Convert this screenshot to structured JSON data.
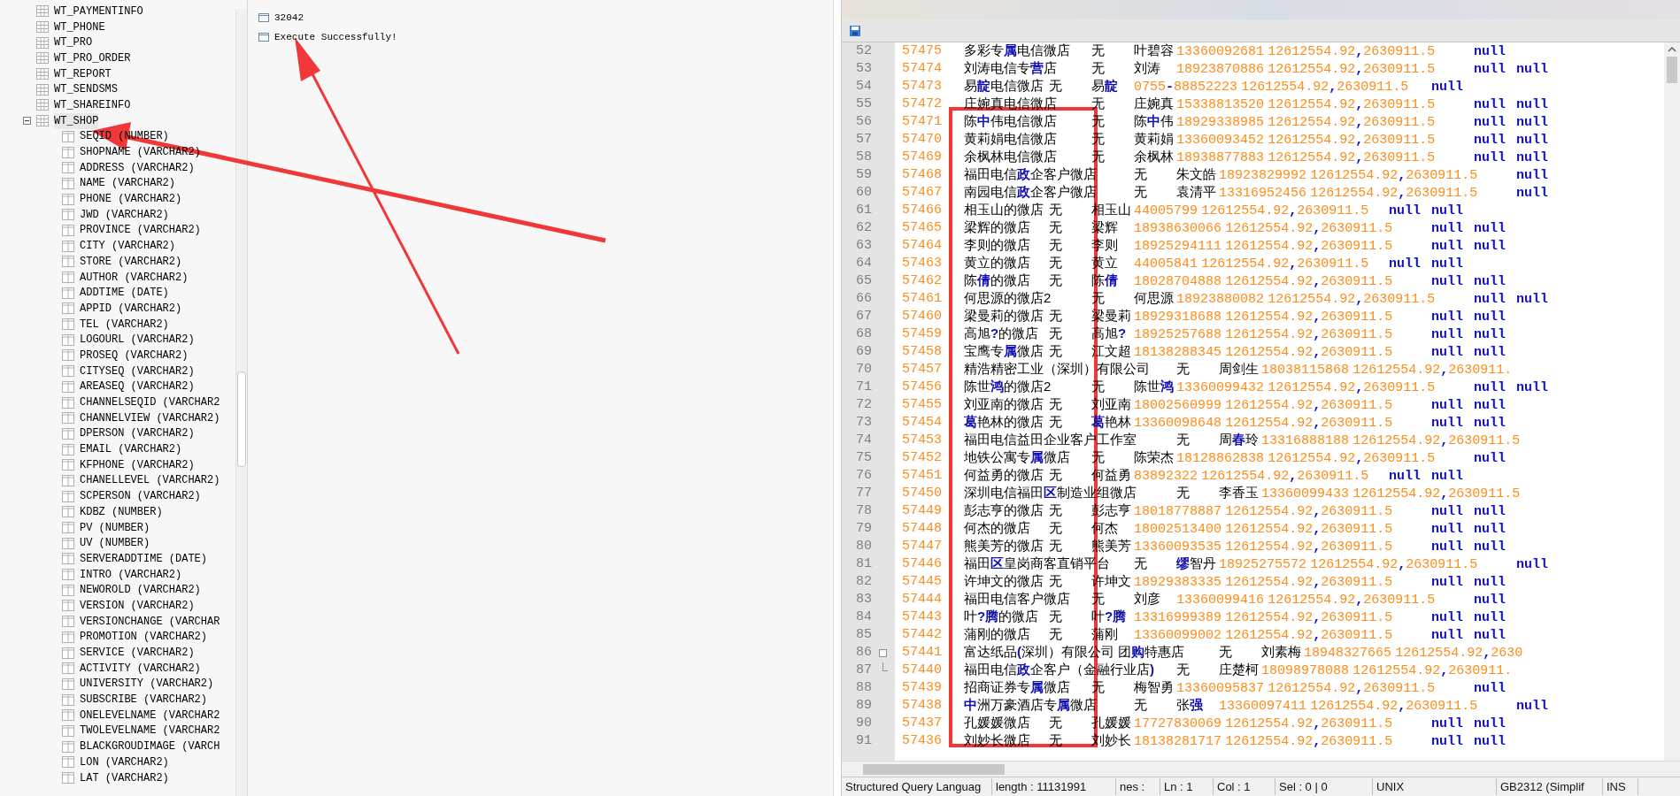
{
  "tree": {
    "items": [
      {
        "label": "WT_PAYMENTINFO",
        "expanded": false,
        "selected": false
      },
      {
        "label": "WT_PHONE",
        "expanded": false,
        "selected": false
      },
      {
        "label": "WT_PRO",
        "expanded": false,
        "selected": false
      },
      {
        "label": "WT_PRO_ORDER",
        "expanded": false,
        "selected": false
      },
      {
        "label": "WT_REPORT",
        "expanded": false,
        "selected": false
      },
      {
        "label": "WT_SENDSMS",
        "expanded": false,
        "selected": false
      },
      {
        "label": "WT_SHAREINFO",
        "expanded": false,
        "selected": false
      },
      {
        "label": "WT_SHOP",
        "expanded": true,
        "selected": true,
        "children": [
          "SEQID (NUMBER)",
          "SHOPNAME (VARCHAR2)",
          "ADDRESS (VARCHAR2)",
          "NAME (VARCHAR2)",
          "PHONE (VARCHAR2)",
          "JWD (VARCHAR2)",
          "PROVINCE (VARCHAR2)",
          "CITY (VARCHAR2)",
          "STORE (VARCHAR2)",
          "AUTHOR (VARCHAR2)",
          "ADDTIME (DATE)",
          "APPID (VARCHAR2)",
          "TEL (VARCHAR2)",
          "LOGOURL (VARCHAR2)",
          "PROSEQ (VARCHAR2)",
          "CITYSEQ (VARCHAR2)",
          "AREASEQ (VARCHAR2)",
          "CHANNELSEQID (VARCHAR2",
          "CHANNELVIEW (VARCHAR2)",
          "DPERSON (VARCHAR2)",
          "EMAIL (VARCHAR2)",
          "KFPHONE (VARCHAR2)",
          "CHANELLEVEL (VARCHAR2)",
          "SCPERSON (VARCHAR2)",
          "KDBZ (NUMBER)",
          "PV (NUMBER)",
          "UV (NUMBER)",
          "SERVERADDTIME (DATE)",
          "INTRO (VARCHAR2)",
          "NEWOROLD (VARCHAR2)",
          "VERSION (VARCHAR2)",
          "VERSIONCHANGE (VARCHAR",
          "PROMOTION (VARCHAR2)",
          "SERVICE (VARCHAR2)",
          "ACTIVITY (VARCHAR2)",
          "UNIVERSITY (VARCHAR2)",
          "SUBSCRIBE (VARCHAR2)",
          "ONELEVELNAME (VARCHAR2",
          "TWOLEVELNAME (VARCHAR2",
          "BLACKGROUDIMAGE (VARCH",
          "LON (VARCHAR2)",
          "LAT (VARCHAR2)"
        ]
      }
    ]
  },
  "results": [
    "32042",
    "Execute Successfully!"
  ],
  "editor": {
    "lines": [
      {
        "n": "52",
        "id": "57475",
        "shop": "多彩专**属**电信微店",
        "flag": "无",
        "person": "叶碧容",
        "phone": "13360092681",
        "coords": "12612554.92**,**2630911.5",
        "nulls": [
          "null"
        ]
      },
      {
        "n": "53",
        "id": "57474",
        "shop": "刘涛电信专**营**店",
        "flag": "无",
        "person": "刘涛",
        "phone": "18923870886",
        "coords": "12612554.92**,**2630911.5",
        "nulls": [
          "null",
          "null"
        ]
      },
      {
        "n": "54",
        "id": "57473",
        "shop": "易**靛**电信微店",
        "flag": "无",
        "person": "易**靛**",
        "phone": "0755**-**88852223",
        "coords": "12612554.92**,**2630911.5",
        "nulls": [
          "null"
        ]
      },
      {
        "n": "55",
        "id": "57472",
        "shop": "庄婉真电信微店",
        "flag": "无",
        "person": "庄婉真",
        "phone": "15338813520",
        "coords": "12612554.92**,**2630911.5",
        "nulls": [
          "null",
          "null"
        ]
      },
      {
        "n": "56",
        "id": "57471",
        "shop": "陈**中**伟电信微店",
        "flag": "无",
        "person": "陈**中**伟",
        "phone": "18929338985",
        "coords": "12612554.92**,**2630911.5",
        "nulls": [
          "null",
          "null"
        ]
      },
      {
        "n": "57",
        "id": "57470",
        "shop": "黄莉娟电信微店",
        "flag": "无",
        "person": "黄莉娟",
        "phone": "13360093452",
        "coords": "12612554.92**,**2630911.5",
        "nulls": [
          "null",
          "null"
        ]
      },
      {
        "n": "58",
        "id": "57469",
        "shop": "余枫林电信微店",
        "flag": "无",
        "person": "余枫林",
        "phone": "18938877883",
        "coords": "12612554.92**,**2630911.5",
        "nulls": [
          "null",
          "null"
        ]
      },
      {
        "n": "59",
        "id": "57468",
        "shop": "福田电信**政**企客户微店",
        "flag": "无",
        "person": "朱文皓",
        "phone": "18923829992",
        "coords": "12612554.92**,**2630911.5",
        "nulls": [
          "null"
        ]
      },
      {
        "n": "60",
        "id": "57467",
        "shop": "南园电信**政**企客户微店",
        "flag": "无",
        "person": "袁清平",
        "phone": "13316952456",
        "coords": "12612554.92**,**2630911.5",
        "nulls": [
          "null"
        ]
      },
      {
        "n": "61",
        "id": "57466",
        "shop": "相玉山的微店",
        "flag": "无",
        "person": "相玉山",
        "phone": "44005799",
        "coords": "12612554.92**,**2630911.5",
        "nulls": [
          "null",
          "null"
        ]
      },
      {
        "n": "62",
        "id": "57465",
        "shop": "梁辉的微店",
        "flag": "无",
        "person": "梁辉",
        "phone": "18938630066",
        "coords": "12612554.92**,**2630911.5",
        "nulls": [
          "null",
          "null"
        ]
      },
      {
        "n": "63",
        "id": "57464",
        "shop": "李则的微店",
        "flag": "无",
        "person": "李则",
        "phone": "18925294111",
        "coords": "12612554.92**,**2630911.5",
        "nulls": [
          "null",
          "null"
        ]
      },
      {
        "n": "64",
        "id": "57463",
        "shop": "黄立的微店",
        "flag": "无",
        "person": "黄立",
        "phone": "44005841",
        "coords": "12612554.92**,**2630911.5",
        "nulls": [
          "null",
          "null"
        ]
      },
      {
        "n": "65",
        "id": "57462",
        "shop": "陈**倩**的微店",
        "flag": "无",
        "person": "陈**倩**",
        "phone": "18028704888",
        "coords": "12612554.92**,**2630911.5",
        "nulls": [
          "null",
          "null"
        ]
      },
      {
        "n": "66",
        "id": "57461",
        "shop": "何思源的微店2",
        "flag": "无",
        "person": "何思源",
        "phone": "18923880082",
        "coords": "12612554.92**,**2630911.5",
        "nulls": [
          "null",
          "null"
        ]
      },
      {
        "n": "67",
        "id": "57460",
        "shop": "梁曼莉的微店",
        "flag": "无",
        "person": "梁曼莉",
        "phone": "18929318688",
        "coords": "12612554.92**,**2630911.5",
        "nulls": [
          "null",
          "null"
        ]
      },
      {
        "n": "68",
        "id": "57459",
        "shop": "高旭**?**的微店",
        "flag": "无",
        "person": "高旭**?**",
        "phone": "18925257688",
        "coords": "12612554.92**,**2630911.5",
        "nulls": [
          "null",
          "null"
        ]
      },
      {
        "n": "69",
        "id": "57458",
        "shop": "宝鹰专**属**微店",
        "flag": "无",
        "person": "江文超",
        "phone": "18138288345",
        "coords": "12612554.92**,**2630911.5",
        "nulls": [
          "null",
          "null"
        ]
      },
      {
        "n": "70",
        "id": "57457",
        "shop": "精浩精密工业（深圳）有限公司",
        "flag": "无",
        "person": "周剑生",
        "phone": "18038115868",
        "coords": "12612554.92**,**2630911."
      },
      {
        "n": "71",
        "id": "57456",
        "shop": "陈世**鸿**的微店2",
        "flag": "无",
        "person": "陈世**鸿**",
        "phone": "13360099432",
        "coords": "12612554.92**,**2630911.5",
        "nulls": [
          "null",
          "null"
        ]
      },
      {
        "n": "72",
        "id": "57455",
        "shop": "刘亚南的微店",
        "flag": "无",
        "person": "刘亚南",
        "phone": "18002560999",
        "coords": "12612554.92**,**2630911.5",
        "nulls": [
          "null",
          "null"
        ]
      },
      {
        "n": "73",
        "id": "57454",
        "shop": "**葛**艳林的微店",
        "flag": "无",
        "person": "**葛**艳林",
        "phone": "13360098648",
        "coords": "12612554.92**,**2630911.5",
        "nulls": [
          "null",
          "null"
        ]
      },
      {
        "n": "74",
        "id": "57453",
        "shop": "福田电信益田企业客户工作室",
        "flag": "无",
        "person": "周**春**玲",
        "phone": "13316888188",
        "coords": "12612554.92**,**2630911.5"
      },
      {
        "n": "75",
        "id": "57452",
        "shop": "地铁公寓专**属**微店",
        "flag": "无",
        "person": "陈荣杰",
        "phone": "18128862838",
        "coords": "12612554.92**,**2630911.5",
        "nulls": [
          "null"
        ]
      },
      {
        "n": "76",
        "id": "57451",
        "shop": "何益勇的微店",
        "flag": "无",
        "person": "何益勇",
        "phone": "83892322",
        "coords": "12612554.92**,**2630911.5",
        "nulls": [
          "null",
          "null"
        ]
      },
      {
        "n": "77",
        "id": "57450",
        "shop": "深圳电信福田**区**制造业组微店",
        "flag": "无",
        "person": "李香玉",
        "phone": "13360099433",
        "coords": "12612554.92**,**2630911.5"
      },
      {
        "n": "78",
        "id": "57449",
        "shop": "彭志亨的微店",
        "flag": "无",
        "person": "彭志亨",
        "phone": "18018778887",
        "coords": "12612554.92**,**2630911.5",
        "nulls": [
          "null",
          "null"
        ]
      },
      {
        "n": "79",
        "id": "57448",
        "shop": "何杰的微店",
        "flag": "无",
        "person": "何杰",
        "phone": "18002513400",
        "coords": "12612554.92**,**2630911.5",
        "nulls": [
          "null",
          "null"
        ]
      },
      {
        "n": "80",
        "id": "57447",
        "shop": "熊美芳的微店",
        "flag": "无",
        "person": "熊美芳",
        "phone": "13360093535",
        "coords": "12612554.92**,**2630911.5",
        "nulls": [
          "null",
          "null"
        ]
      },
      {
        "n": "81",
        "id": "57446",
        "shop": "福田**区**皇岗商客直销平台",
        "flag": "无",
        "person": "**缪**智丹",
        "phone": "18925275572",
        "coords": "12612554.92**,**2630911.5",
        "nulls": [
          "null"
        ]
      },
      {
        "n": "82",
        "id": "57445",
        "shop": "许坤文的微店",
        "flag": "无",
        "person": "许坤文",
        "phone": "18929383335",
        "coords": "12612554.92**,**2630911.5",
        "nulls": [
          "null",
          "null"
        ]
      },
      {
        "n": "83",
        "id": "57444",
        "shop": "福田电信客户微店",
        "flag": "无",
        "person": "刘彦",
        "phone": "13360099416",
        "coords": "12612554.92**,**2630911.5",
        "nulls": [
          "null"
        ]
      },
      {
        "n": "84",
        "id": "57443",
        "shop": "叶**?腾**的微店",
        "flag": "无",
        "person": "叶**?腾**",
        "phone": "13316999389",
        "coords": "12612554.92**,**2630911.5",
        "nulls": [
          "null",
          "null"
        ]
      },
      {
        "n": "85",
        "id": "57442",
        "shop": "蒲刚的微店",
        "flag": "无",
        "person": "蒲刚",
        "phone": "13360099002",
        "coords": "12612554.92**,**2630911.5",
        "nulls": [
          "null",
          "null"
        ]
      },
      {
        "n": "86",
        "id": "57441",
        "shop": "富达纸品**(**深圳）有限公司 团**购**特惠店",
        "flag": "无",
        "person": "刘素梅",
        "phone": "18948327665",
        "coords": "12612554.92**,**2630"
      },
      {
        "n": "87",
        "id": "57440",
        "shop": "福田电信**政**企客户（金融行业店**)**",
        "flag": "无",
        "person": "庄楚柯",
        "phone": "18098978088",
        "coords": "12612554.92**,**2630911."
      },
      {
        "n": "88",
        "id": "57439",
        "shop": "招商证券专**属**微店",
        "flag": "无",
        "person": "梅智勇",
        "phone": "13360095837",
        "coords": "12612554.92**,**2630911.5",
        "nulls": [
          "null"
        ]
      },
      {
        "n": "89",
        "id": "57438",
        "shop": "**中**洲万豪酒店专**属**微店",
        "flag": "无",
        "person": "张**强**",
        "phone": "13360097411",
        "coords": "12612554.92**,**2630911.5",
        "nulls": [
          "null"
        ]
      },
      {
        "n": "90",
        "id": "57437",
        "shop": "孔媛媛微店",
        "flag": "无",
        "person": "孔媛媛",
        "phone": "17727830069",
        "coords": "12612554.92**,**2630911.5",
        "nulls": [
          "null",
          "null"
        ]
      },
      {
        "n": "91",
        "id": "57436",
        "shop": "刘妙长微店",
        "flag": "无",
        "person": "刘妙长",
        "phone": "18138281717",
        "coords": "12612554.92**,**2630911.5",
        "nulls": [
          "null",
          "null"
        ]
      }
    ]
  },
  "status_bar": [
    "Structured Query Languag",
    "length : 11131991",
    "nes :",
    "Ln : 1",
    "Col : 1",
    "Sel : 0 | 0",
    "UNIX",
    "GB2312 (Simplif",
    "INS"
  ]
}
